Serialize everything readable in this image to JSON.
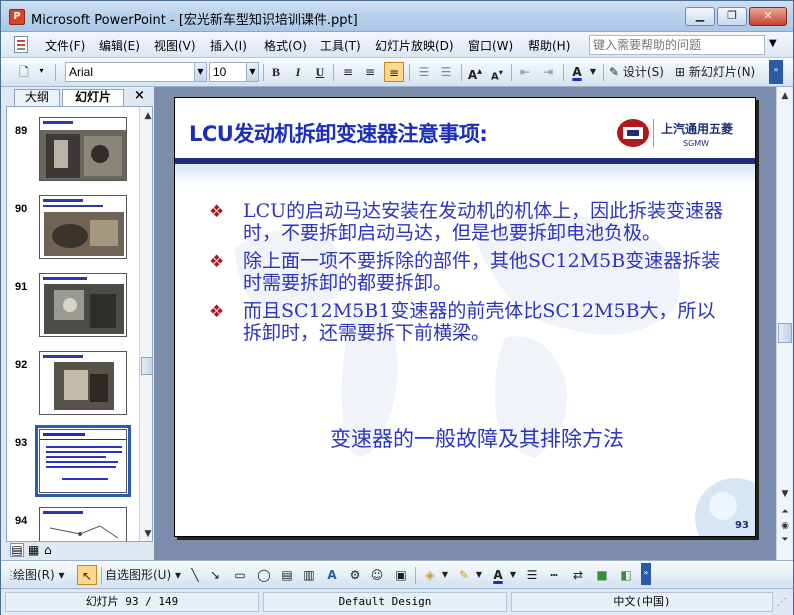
{
  "window": {
    "title": "Microsoft PowerPoint - [宏光新车型知识培训课件.ppt]",
    "app_icon": "powerpoint-icon",
    "controls": [
      "minimize-icon",
      "restore-icon",
      "close-icon"
    ]
  },
  "menu": {
    "items": [
      "文件(F)",
      "编辑(E)",
      "视图(V)",
      "插入(I)",
      "格式(O)",
      "工具(T)",
      "幻灯片放映(D)",
      "窗口(W)",
      "帮助(H)"
    ],
    "help_placeholder": "键入需要帮助的问题"
  },
  "formatting": {
    "font": "Arial",
    "font_size": "10",
    "bold": "B",
    "italic": "I",
    "underline": "U",
    "design_label": "设计(S)",
    "new_slide_label": "新幻灯片(N)"
  },
  "pane": {
    "tabs": [
      "大纲",
      "幻灯片"
    ],
    "active_tab": "幻灯片",
    "close": "×",
    "slides": [
      {
        "num": "89",
        "kind": "photo"
      },
      {
        "num": "90",
        "kind": "photo"
      },
      {
        "num": "91",
        "kind": "photo"
      },
      {
        "num": "92",
        "kind": "photo"
      },
      {
        "num": "93",
        "kind": "text",
        "selected": true
      },
      {
        "num": "94",
        "kind": "diagram"
      }
    ]
  },
  "slide": {
    "title": "LCU发动机拆卸变速器注意事项:",
    "logo_text": "上汽通用五菱",
    "logo_sub": "SGMW",
    "bullets": [
      "LCU的启动马达安装在发动机的机体上，因此拆装变速器时，不要拆卸启动马达，但是也要拆卸电池负极。",
      "除上面一项不要拆除的部件，其他SC12M5B变速器拆装时需要拆卸的都要拆卸。",
      "而且SC12M5B1变速器的前壳体比SC12M5B大，所以拆卸时，还需要拆下前横梁。"
    ],
    "subtitle": "变速器的一般故障及其排除方法",
    "page_number": "93"
  },
  "drawing": {
    "draw_label": "绘图(R)",
    "autoshape_label": "自选图形(U)"
  },
  "status": {
    "slide_indicator": "幻灯片 93 / 149",
    "design": "Default Design",
    "language": "中文(中国)"
  },
  "colors": {
    "title_blue": "#1a2dbd",
    "body_blue": "#2b35c0",
    "bullet_red": "#b0191c",
    "navy_rule": "#1f2f7c"
  }
}
